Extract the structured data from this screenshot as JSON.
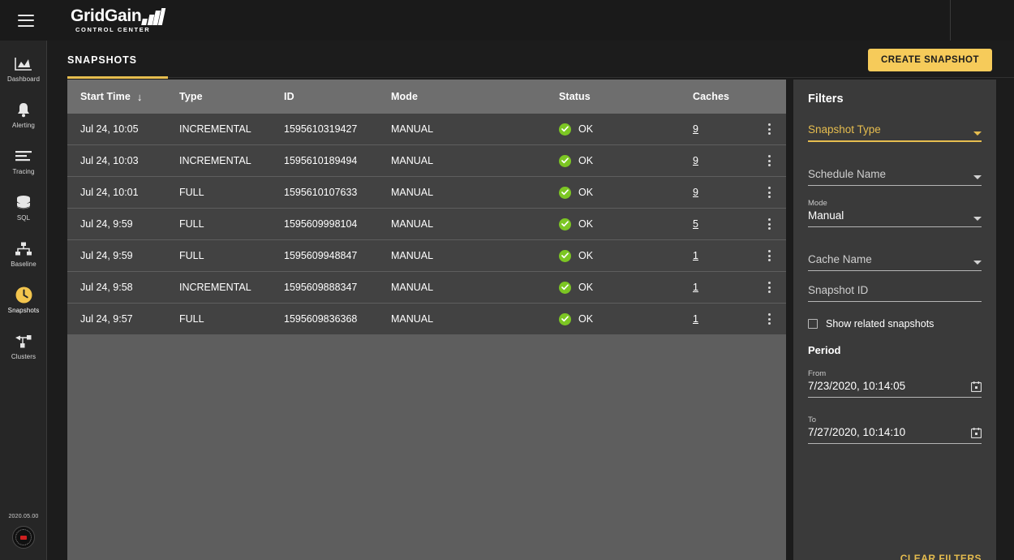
{
  "header": {
    "menu_icon": "hamburger-icon",
    "brand_name": "GridGain",
    "brand_subtitle": "CONTROL CENTER"
  },
  "sidebar": {
    "items": [
      {
        "label": "Dashboard",
        "icon": "dashboard-icon",
        "active": false
      },
      {
        "label": "Alerting",
        "icon": "bell-icon",
        "active": false
      },
      {
        "label": "Tracing",
        "icon": "lines-icon",
        "active": false
      },
      {
        "label": "SQL",
        "icon": "database-icon",
        "active": false
      },
      {
        "label": "Baseline",
        "icon": "topology-icon",
        "active": false
      },
      {
        "label": "Snapshots",
        "icon": "clock-icon",
        "active": true
      },
      {
        "label": "Clusters",
        "icon": "cluster-icon",
        "active": false
      }
    ],
    "version": "2020.05.00",
    "seal_icon": "certification-seal-icon"
  },
  "tabs": {
    "items": [
      {
        "label": "SNAPSHOTS",
        "active": true
      }
    ]
  },
  "toolbar": {
    "create_label": "CREATE SNAPSHOT"
  },
  "table": {
    "columns": [
      "Start Time",
      "Type",
      "ID",
      "Mode",
      "Status",
      "Caches"
    ],
    "sort_column": "Start Time",
    "sort_direction_icon": "↓",
    "row_menu_icon": "kebab-menu-icon",
    "status_icon": "check-circle-icon",
    "rows": [
      {
        "start_time": "Jul 24, 10:05",
        "type": "INCREMENTAL",
        "id": "1595610319427",
        "mode": "MANUAL",
        "status": "OK",
        "caches": "9"
      },
      {
        "start_time": "Jul 24, 10:03",
        "type": "INCREMENTAL",
        "id": "1595610189494",
        "mode": "MANUAL",
        "status": "OK",
        "caches": "9"
      },
      {
        "start_time": "Jul 24, 10:01",
        "type": "FULL",
        "id": "1595610107633",
        "mode": "MANUAL",
        "status": "OK",
        "caches": "9"
      },
      {
        "start_time": "Jul 24, 9:59",
        "type": "FULL",
        "id": "1595609998104",
        "mode": "MANUAL",
        "status": "OK",
        "caches": "5"
      },
      {
        "start_time": "Jul 24, 9:59",
        "type": "FULL",
        "id": "1595609948847",
        "mode": "MANUAL",
        "status": "OK",
        "caches": "1"
      },
      {
        "start_time": "Jul 24, 9:58",
        "type": "INCREMENTAL",
        "id": "1595609888347",
        "mode": "MANUAL",
        "status": "OK",
        "caches": "1"
      },
      {
        "start_time": "Jul 24, 9:57",
        "type": "FULL",
        "id": "1595609836368",
        "mode": "MANUAL",
        "status": "OK",
        "caches": "1"
      }
    ]
  },
  "filters": {
    "title": "Filters",
    "snapshot_type": {
      "label": "Snapshot Type",
      "value": "",
      "focused": true
    },
    "schedule_name": {
      "label": "Schedule Name",
      "value": ""
    },
    "mode": {
      "label": "Mode",
      "value": "Manual"
    },
    "cache_name": {
      "label": "Cache Name",
      "value": ""
    },
    "snapshot_id": {
      "label": "Snapshot ID",
      "value": ""
    },
    "show_related": {
      "label": "Show related snapshots",
      "checked": false
    },
    "period_title": "Period",
    "from": {
      "label": "From",
      "value": "7/23/2020, 10:14:05"
    },
    "to": {
      "label": "To",
      "value": "7/27/2020, 10:14:10"
    },
    "clear_label": "CLEAR FILTERS",
    "calendar_icon": "calendar-icon"
  },
  "colors": {
    "accent": "#e6bd4f",
    "button": "#f6cb5a",
    "status_ok": "#7cc623",
    "header_row": "#6e6e6e",
    "row": "#424242",
    "panel": "#3a3a3a"
  }
}
